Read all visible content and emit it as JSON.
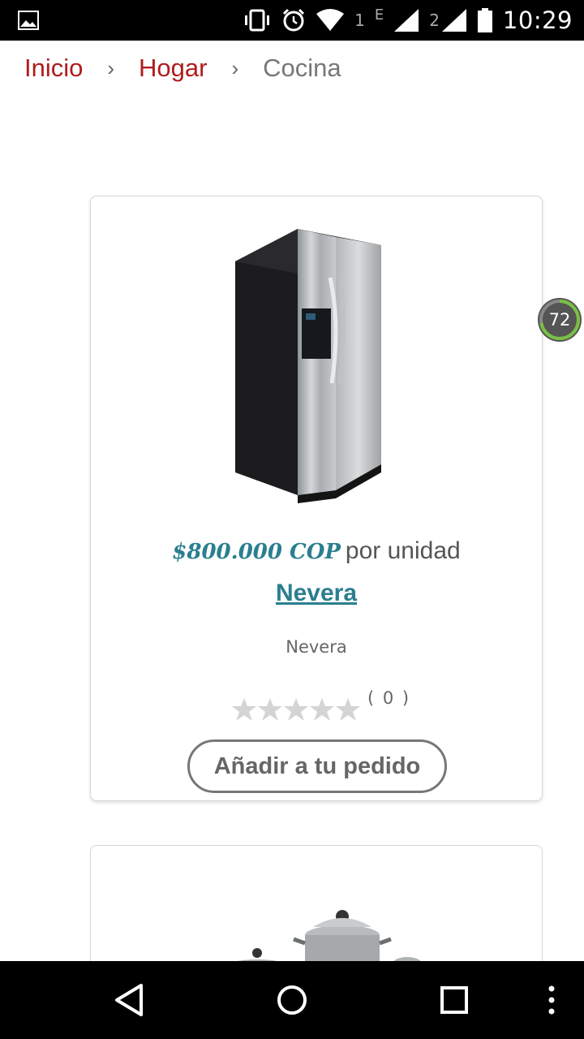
{
  "status_bar": {
    "time": "10:29",
    "sim1_label": "1",
    "sim1_network": "E",
    "sim2_label": "2",
    "icons": [
      "image-notification-icon",
      "vibrate-icon",
      "alarm-icon",
      "wifi-icon",
      "signal-icon",
      "battery-icon"
    ]
  },
  "breadcrumb": {
    "items": [
      "Inicio",
      "Hogar",
      "Cocina"
    ],
    "separator": "›"
  },
  "product": {
    "image_icon": "refrigerator-image",
    "price": "$800.000 COP",
    "per_unit": "por unidad",
    "name": "Nevera",
    "description": "Nevera",
    "rating_stars": 0,
    "rating_max": 5,
    "review_count": "( 0 )",
    "add_button": "Añadir a tu pedido"
  },
  "second_product": {
    "image_icon": "cookware-pots-image"
  },
  "score_badge": {
    "value": "72",
    "progress_fraction": 0.72,
    "color": "#7bc043"
  },
  "colors": {
    "breadcrumb_link": "#b01c1c",
    "accent": "#2a7f8f"
  },
  "nav_bar": {
    "icons": [
      "back-icon",
      "home-icon",
      "recents-icon",
      "overflow-menu-icon"
    ]
  }
}
